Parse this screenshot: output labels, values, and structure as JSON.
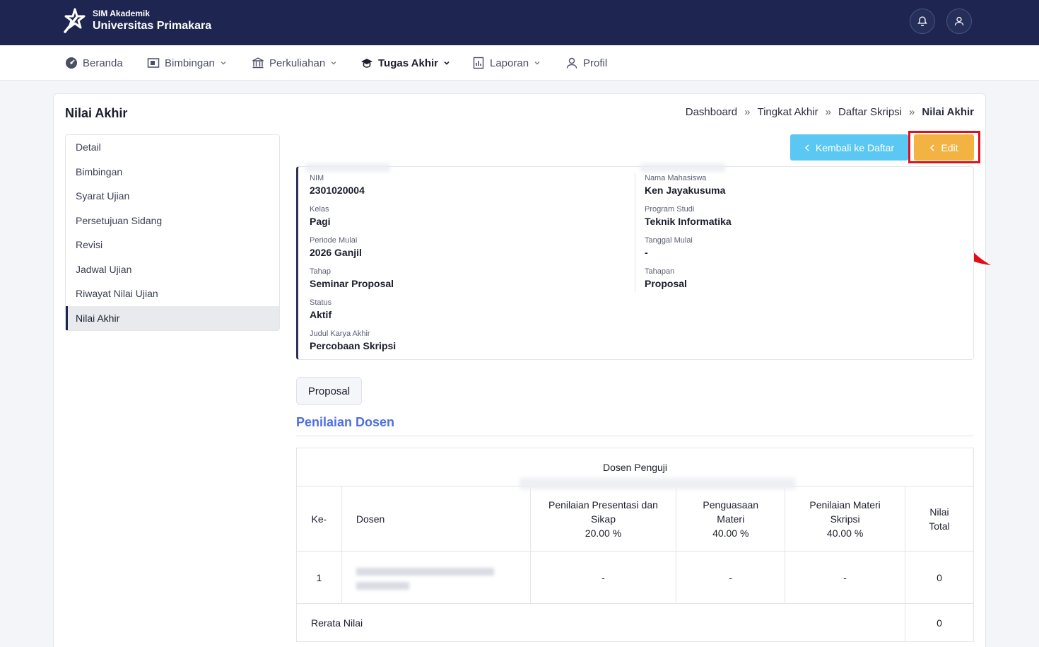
{
  "header": {
    "brand_subtitle": "SIM Akademik",
    "brand_title": "Universitas Primakara"
  },
  "nav": {
    "items": [
      {
        "label": "Beranda",
        "icon": "dashboard-icon"
      },
      {
        "label": "Bimbingan",
        "icon": "presentation-icon"
      },
      {
        "label": "Perkuliahan",
        "icon": "building-icon"
      },
      {
        "label": "Tugas Akhir",
        "icon": "graduation-cap-icon"
      },
      {
        "label": "Laporan",
        "icon": "report-icon"
      },
      {
        "label": "Profil",
        "icon": "user-icon"
      }
    ],
    "active": "Tugas Akhir"
  },
  "page": {
    "title": "Nilai Akhir",
    "breadcrumb": [
      "Dashboard",
      "Tingkat Akhir",
      "Daftar Skripsi",
      "Nilai Akhir"
    ]
  },
  "sidemenu": {
    "items": [
      "Detail",
      "Bimbingan",
      "Syarat Ujian",
      "Persetujuan Sidang",
      "Revisi",
      "Jadwal Ujian",
      "Riwayat Nilai Ujian",
      "Nilai Akhir"
    ],
    "active": "Nilai Akhir"
  },
  "actions": {
    "back_label": "Kembali ke Daftar",
    "edit_label": "Edit"
  },
  "student": {
    "nim_label": "NIM",
    "nim": "2301020004",
    "nama_label": "Nama Mahasiswa",
    "nama": "Ken Jayakusuma",
    "kelas_label": "Kelas",
    "kelas": "Pagi",
    "prodi_label": "Program Studi",
    "prodi": "Teknik Informatika",
    "periode_label": "Periode Mulai",
    "periode": "2026 Ganjil",
    "tgl_label": "Tanggal Mulai",
    "tgl": "-",
    "tahap_label": "Tahap",
    "tahap": "Seminar Proposal",
    "tahapan_label": "Tahapan",
    "tahapan": "Proposal",
    "status_label": "Status",
    "status": "Aktif",
    "judul_label": "Judul Karya Akhir",
    "judul": "Percobaan Skripsi"
  },
  "tab": {
    "label": "Proposal"
  },
  "section": {
    "title": "Penilaian Dosen"
  },
  "table": {
    "group_header": "Dosen Penguji",
    "col_no": "Ke-",
    "col_dosen": "Dosen",
    "col_presentasi": "Penilaian Presentasi dan Sikap",
    "col_presentasi_pct": "20.00 %",
    "col_penguasaan": "Penguasaan Materi",
    "col_penguasaan_pct": "40.00 %",
    "col_materi": "Penilaian Materi Skripsi",
    "col_materi_pct": "40.00 %",
    "col_total": "Nilai Total",
    "rows": [
      {
        "no": "1",
        "presentasi": "-",
        "penguasaan": "-",
        "materi": "-",
        "total": "0"
      }
    ],
    "avg_label": "Rerata Nilai",
    "avg_value": "0"
  },
  "colors": {
    "header_bg": "#1d2550",
    "back_button": "#5bc7f3",
    "edit_button": "#f2b343",
    "section_title": "#4d6fe0",
    "highlight": "#e0111b"
  }
}
